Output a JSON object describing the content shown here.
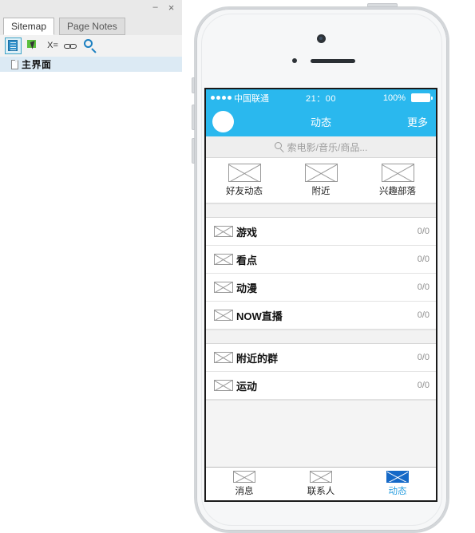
{
  "panel": {
    "window_buttons": {
      "minimize": "–",
      "close": "×"
    },
    "tabs": [
      {
        "id": "sitemap",
        "label": "Sitemap",
        "active": true
      },
      {
        "id": "pagenotes",
        "label": "Page Notes",
        "active": false
      }
    ],
    "toolbar": [
      {
        "id": "add-page",
        "icon": "add-page-icon",
        "label": ""
      },
      {
        "id": "add-child",
        "icon": "add-child-icon",
        "label": ""
      },
      {
        "id": "rename",
        "icon": "rename-icon",
        "label": "X="
      },
      {
        "id": "link",
        "icon": "link-icon",
        "label": ""
      },
      {
        "id": "search",
        "icon": "search-icon",
        "label": ""
      }
    ],
    "tree": [
      {
        "id": "main",
        "label": "主界面",
        "icon": "page-icon",
        "selected": true
      }
    ]
  },
  "phone": {
    "status_bar": {
      "carrier": "中国联通",
      "signal_dots": 4,
      "time": "21：00",
      "battery_percent": "100%",
      "battery_icon": "battery-full-icon"
    },
    "nav_bar": {
      "avatar": "avatar-icon",
      "title": "动态",
      "more_label": "更多"
    },
    "search": {
      "icon": "search-icon",
      "placeholder": "索电影/音乐/商品..."
    },
    "quick_actions": [
      {
        "id": "friend-feed",
        "label": "好友动态",
        "icon": "image-placeholder-icon"
      },
      {
        "id": "nearby",
        "label": "附近",
        "icon": "image-placeholder-icon"
      },
      {
        "id": "interest-tribe",
        "label": "兴趣部落",
        "icon": "image-placeholder-icon"
      }
    ],
    "list_group_1": [
      {
        "id": "games",
        "label": "游戏",
        "count": "0/0",
        "icon": "image-placeholder-icon"
      },
      {
        "id": "highlights",
        "label": "看点",
        "count": "0/0",
        "icon": "image-placeholder-icon"
      },
      {
        "id": "anime",
        "label": "动漫",
        "count": "0/0",
        "icon": "image-placeholder-icon"
      },
      {
        "id": "now-live",
        "label": "NOW直播",
        "count": "0/0",
        "icon": "image-placeholder-icon"
      }
    ],
    "list_group_2": [
      {
        "id": "nearby-groups",
        "label": "附近的群",
        "count": "0/0",
        "icon": "image-placeholder-icon"
      },
      {
        "id": "sports",
        "label": "运动",
        "count": "0/0",
        "icon": "image-placeholder-icon"
      }
    ],
    "tab_bar": [
      {
        "id": "messages",
        "label": "消息",
        "icon": "image-placeholder-icon",
        "active": false
      },
      {
        "id": "contacts",
        "label": "联系人",
        "icon": "image-placeholder-icon",
        "active": false
      },
      {
        "id": "feed",
        "label": "动态",
        "icon": "image-placeholder-icon",
        "active": true
      }
    ],
    "hardware": {
      "camera": "front-camera",
      "speaker": "earpiece-speaker",
      "sensor": "proximity-sensor"
    }
  },
  "colors": {
    "accent_blue": "#2AB8EE",
    "active_tab_blue": "#1569C7",
    "active_label_blue": "#2A9FE0",
    "tree_selection": "#DCEAF4",
    "panel_bg": "#E9E9E9"
  }
}
